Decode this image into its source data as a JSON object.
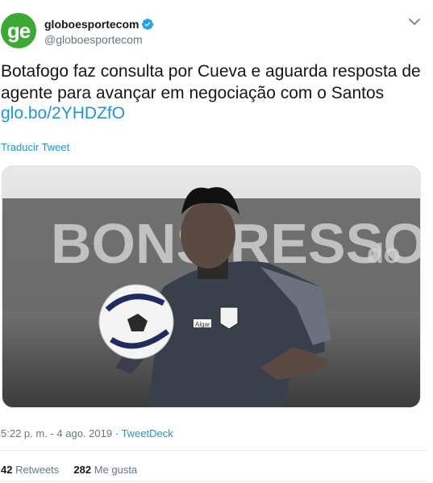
{
  "account": {
    "avatar_text": "ge",
    "name": "globoesportecom",
    "handle": "@globoesportecom",
    "verified": true
  },
  "tweet": {
    "text": "Botafogo faz consulta por Cueva e aguarda resposta de agente para avançar em negociação com o Santos",
    "link": "glo.bo/2YHDZfO",
    "translate_label": "Traducir Tweet"
  },
  "media": {
    "background_sign_text": "BONS RESSO",
    "background_sign_right": "do",
    "jersey_brand": "Algar",
    "description_icon": "soccer-ball-icon"
  },
  "meta": {
    "time": "5:22 p. m.",
    "date": "4 ago. 2019",
    "separator": "·",
    "source": "TweetDeck"
  },
  "stats": {
    "retweets_count": "42",
    "retweets_label": "Retweets",
    "likes_count": "282",
    "likes_label": "Me gusta"
  },
  "colors": {
    "brand_green": "#3aaa35",
    "link_blue": "#1b95e0",
    "muted": "#657786"
  }
}
